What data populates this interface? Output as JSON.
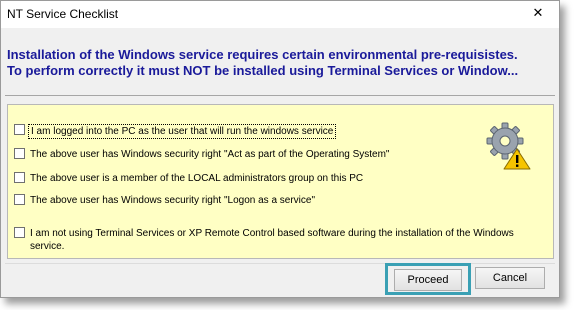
{
  "window": {
    "title": "NT Service Checklist",
    "close_glyph": "✕"
  },
  "header": {
    "line1": "Installation of the Windows service requires certain environmental pre-requisistes.",
    "line2": "To perform correctly it must NOT be installed using Terminal Services or Window..."
  },
  "checklist": [
    {
      "label": "I am logged into the PC as the user that will run the windows service",
      "checked": false,
      "focused": true
    },
    {
      "label": "The above user has Windows security right \"Act as part of the Operating System\"",
      "checked": false
    },
    {
      "label": "The above user is a member of the LOCAL administrators group on this PC",
      "checked": false
    },
    {
      "label": "The above user has Windows security right \"Logon as a service\"",
      "checked": false
    },
    {
      "label": "I am not using Terminal Services or XP Remote Control based software during the installation of the Windows service.",
      "checked": false
    }
  ],
  "icons": {
    "panel_icon": "gear-warning-icon",
    "close_icon": "close-icon"
  },
  "buttons": {
    "proceed": "Proceed",
    "cancel": "Cancel"
  },
  "colors": {
    "header_text": "#1a1a9a",
    "panel_bg": "#ffffc4",
    "highlight_border": "#3aa0b4"
  }
}
